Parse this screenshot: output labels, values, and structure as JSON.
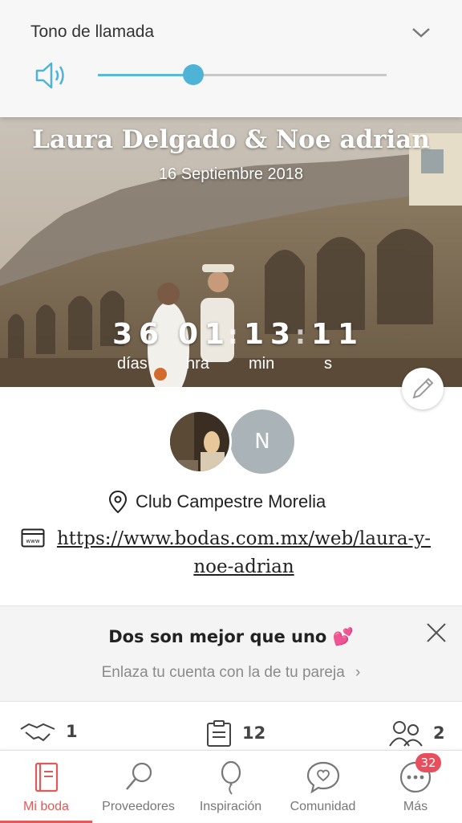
{
  "volume_panel": {
    "title": "Tono de llamada",
    "level": 0.33,
    "accent": "#4fb3d6"
  },
  "hero": {
    "title": "Laura Delgado & Noe adrian",
    "date": "16 Septiembre 2018",
    "countdown": {
      "days": "36",
      "hours": "01",
      "minutes": "13",
      "seconds": "11",
      "days_label": "días",
      "hours_label": "hra",
      "minutes_label": "min",
      "seconds_label": "s"
    }
  },
  "profile": {
    "partner_initial": "N",
    "venue": "Club Campestre Morelia",
    "website": "https://www.bodas.com.mx/web/laura-y-noe-adrian"
  },
  "partner_card": {
    "title": "Dos son mejor que uno",
    "subtitle": "Enlaza tu cuenta con la de tu pareja",
    "chevron": "›"
  },
  "stats": {
    "vendors": "1",
    "tasks": "12",
    "guests": "2"
  },
  "bottom_nav": {
    "items": [
      {
        "label": "Mi boda",
        "icon": "notebook-icon"
      },
      {
        "label": "Proveedores",
        "icon": "magnifier-icon"
      },
      {
        "label": "Inspiración",
        "icon": "balloon-icon"
      },
      {
        "label": "Comunidad",
        "icon": "chat-heart-icon"
      },
      {
        "label": "Más",
        "icon": "more-dots-icon"
      }
    ],
    "more_badge": "32",
    "active_color": "#e05a5a"
  }
}
